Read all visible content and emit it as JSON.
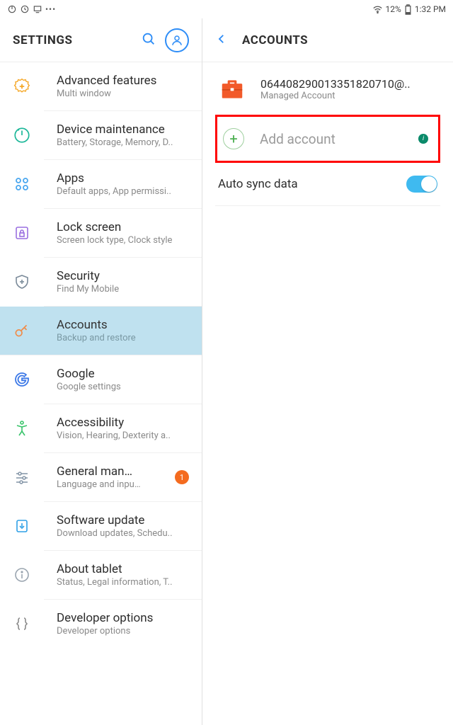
{
  "statusbar": {
    "battery": "12%",
    "time": "1:32 PM"
  },
  "header": {
    "title": "SETTINGS"
  },
  "sidebar": {
    "items": [
      {
        "title": "Advanced features",
        "sub": "Multi window"
      },
      {
        "title": "Device maintenance",
        "sub": "Battery, Storage, Memory, D.."
      },
      {
        "title": "Apps",
        "sub": "Default apps, App permissi.."
      },
      {
        "title": "Lock screen",
        "sub": "Screen lock type, Clock style"
      },
      {
        "title": "Security",
        "sub": "Find My Mobile"
      },
      {
        "title": "Accounts",
        "sub": "Backup and restore"
      },
      {
        "title": "Google",
        "sub": "Google settings"
      },
      {
        "title": "Accessibility",
        "sub": "Vision, Hearing, Dexterity a.."
      },
      {
        "title": "General man…",
        "sub": "Language and inpu…",
        "badge": "1"
      },
      {
        "title": "Software update",
        "sub": "Download updates, Schedu.."
      },
      {
        "title": "About tablet",
        "sub": "Status, Legal information, T.."
      },
      {
        "title": "Developer options",
        "sub": "Developer options"
      }
    ]
  },
  "detail": {
    "title": "ACCOUNTS",
    "account": {
      "name": "064408290013351820710@..",
      "sub": "Managed Account"
    },
    "add_label": "Add account",
    "info_char": "i",
    "autosync_label": "Auto sync data",
    "autosync_on": true
  }
}
